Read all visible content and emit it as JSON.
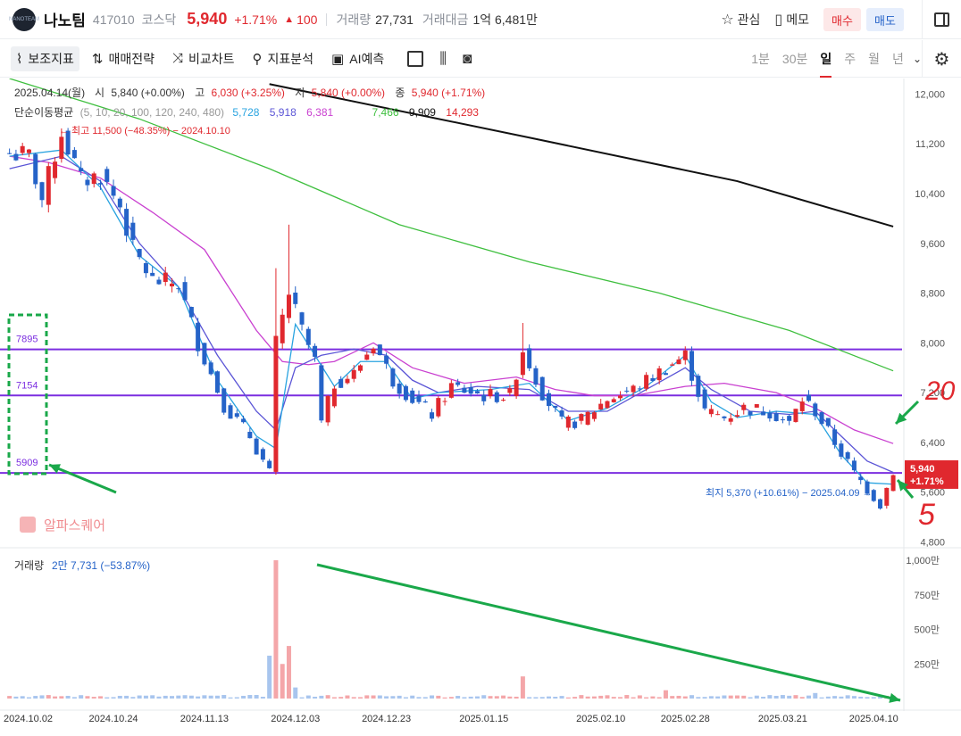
{
  "header": {
    "logo_text": "NANOTEAM",
    "name": "나노팀",
    "code": "417010",
    "market": "코스닥",
    "price": "5,940",
    "change_pct": "+1.71%",
    "change_arrow": "▲",
    "change_abs": "100",
    "volume_label": "거래량",
    "volume": "27,731",
    "amount_label": "거래대금",
    "amount": "1억 6,481만",
    "watch_label": "관심",
    "memo_label": "메모",
    "buy_label": "매수",
    "sell_label": "매도",
    "colors": {
      "up": "#e0282e",
      "down": "#2563c8"
    }
  },
  "toolbar": {
    "tools": [
      "보조지표",
      "매매전략",
      "비교차트",
      "지표분석",
      "AI예측"
    ],
    "periods": [
      "1분",
      "30분",
      "일",
      "주",
      "월",
      "년"
    ],
    "selected_period": "일"
  },
  "ohlc_info": {
    "date": "2025.04.14(월)",
    "open_label": "시",
    "open": "5,840 (+0.00%)",
    "high_label": "고",
    "high": "6,030 (+3.25%)",
    "low_label": "저",
    "low": "5,840 (+0.00%)",
    "close_label": "종",
    "close": "5,940 (+1.71%)"
  },
  "ma_info": {
    "label": "단순이동평균",
    "periods": "(5, 10, 20, 100, 120, 240, 480)",
    "values": [
      {
        "v": "5,728",
        "color": "#29a3e0"
      },
      {
        "v": "5,918",
        "color": "#5b55d6"
      },
      {
        "v": "6,381",
        "color": "#c940d0"
      },
      {
        "v": "7,466",
        "color": "#3fbf3f"
      },
      {
        "v": "9,909",
        "color": "#111111"
      },
      {
        "v": "14,293",
        "color": "#e0282e"
      }
    ]
  },
  "chart_data": {
    "type": "candlestick",
    "y_ticks": [
      "12,000",
      "11,200",
      "10,400",
      "9,600",
      "8,800",
      "8,000",
      "7,200",
      "6,400",
      "5,600",
      "4,800"
    ],
    "y_tick_values": [
      12000,
      11200,
      10400,
      9600,
      8800,
      8000,
      7200,
      6400,
      5600,
      4800
    ],
    "ylim": [
      4720,
      12250
    ],
    "x_ticks": [
      "2024.10.02",
      "2024.10.24",
      "2024.11.13",
      "2024.12.03",
      "2024.12.23",
      "2025.01.15",
      "2025.02.10",
      "2025.02.28",
      "2025.03.21",
      "2025.04.10"
    ],
    "x_tick_index": [
      0,
      16,
      30,
      44,
      58,
      73,
      91,
      104,
      119,
      133
    ],
    "horizontal_lines": [
      {
        "label": "7895",
        "value": 7895,
        "color": "#7b2ee0"
      },
      {
        "label": "7154",
        "value": 7154,
        "color": "#7b2ee0"
      },
      {
        "label": "5909",
        "value": 5909,
        "color": "#7b2ee0"
      }
    ],
    "last_price_badge": {
      "value": 5940,
      "price": "5,940",
      "pct": "+1.71%"
    },
    "annotations": {
      "high": "최고 11,500 (−48.35%) − 2024.10.10",
      "low": "최지 5,370 (+10.61%) − 2025.04.09",
      "hand_20": "20",
      "hand_5": "5"
    },
    "watermark": "알파스퀘어",
    "volume": {
      "label": "거래량",
      "value": "2만 7,731 (−53.87%)",
      "ticks": [
        "1,000만",
        "750만",
        "500만",
        "250만"
      ],
      "tick_values": [
        1000,
        750,
        500,
        250
      ],
      "max": 1000,
      "unit": "만"
    },
    "keypoints": [
      {
        "i": 0,
        "c": 11050
      },
      {
        "i": 3,
        "c": 11000
      },
      {
        "i": 5,
        "c": 10300
      },
      {
        "i": 8,
        "c": 11400
      },
      {
        "i": 11,
        "c": 10600
      },
      {
        "i": 14,
        "c": 10700
      },
      {
        "i": 17,
        "c": 10200
      },
      {
        "i": 19,
        "c": 9500
      },
      {
        "i": 22,
        "c": 9000
      },
      {
        "i": 26,
        "c": 8950
      },
      {
        "i": 29,
        "c": 8000
      },
      {
        "i": 33,
        "c": 7000
      },
      {
        "i": 37,
        "c": 6500
      },
      {
        "i": 40,
        "c": 5900
      },
      {
        "i": 41,
        "c": 8000
      },
      {
        "i": 43,
        "c": 8800
      },
      {
        "i": 45,
        "c": 8200
      },
      {
        "i": 47,
        "c": 7700
      },
      {
        "i": 48,
        "c": 6700
      },
      {
        "i": 50,
        "c": 7350
      },
      {
        "i": 53,
        "c": 7500
      },
      {
        "i": 56,
        "c": 8000
      },
      {
        "i": 59,
        "c": 7400
      },
      {
        "i": 62,
        "c": 7100
      },
      {
        "i": 65,
        "c": 6850
      },
      {
        "i": 68,
        "c": 7300
      },
      {
        "i": 73,
        "c": 7150
      },
      {
        "i": 77,
        "c": 7150
      },
      {
        "i": 79,
        "c": 7900
      },
      {
        "i": 82,
        "c": 7200
      },
      {
        "i": 85,
        "c": 6700
      },
      {
        "i": 88,
        "c": 6750
      },
      {
        "i": 92,
        "c": 7100
      },
      {
        "i": 96,
        "c": 7250
      },
      {
        "i": 101,
        "c": 7600
      },
      {
        "i": 104,
        "c": 7800
      },
      {
        "i": 107,
        "c": 6900
      },
      {
        "i": 110,
        "c": 6800
      },
      {
        "i": 113,
        "c": 6950
      },
      {
        "i": 117,
        "c": 6900
      },
      {
        "i": 120,
        "c": 6700
      },
      {
        "i": 122,
        "c": 7100
      },
      {
        "i": 124,
        "c": 6900
      },
      {
        "i": 127,
        "c": 6400
      },
      {
        "i": 130,
        "c": 5900
      },
      {
        "i": 132,
        "c": 5650
      },
      {
        "i": 134,
        "c": 5400
      },
      {
        "i": 136,
        "c": 5940
      }
    ],
    "volume_spikes": [
      {
        "i": 41,
        "v": 1000
      },
      {
        "i": 40,
        "v": 310
      },
      {
        "i": 43,
        "v": 380
      },
      {
        "i": 42,
        "v": 250
      },
      {
        "i": 79,
        "v": 160
      },
      {
        "i": 44,
        "v": 80
      },
      {
        "i": 101,
        "v": 60
      },
      {
        "i": 124,
        "v": 40
      }
    ],
    "ma_lines": [
      {
        "name": "480",
        "color": "#111111",
        "points": [
          [
            40,
            12160
          ],
          [
            80,
            11300
          ],
          [
            112,
            10600
          ],
          [
            136,
            9870
          ]
        ]
      },
      {
        "name": "240",
        "color": "#3fbf3f",
        "points": [
          [
            0,
            12250
          ],
          [
            20,
            11600
          ],
          [
            40,
            10800
          ],
          [
            60,
            9900
          ],
          [
            80,
            9300
          ],
          [
            100,
            8800
          ],
          [
            120,
            8200
          ],
          [
            136,
            7550
          ]
        ]
      },
      {
        "name": "20",
        "color": "#c940d0",
        "points": [
          [
            0,
            11000
          ],
          [
            6,
            10900
          ],
          [
            14,
            10650
          ],
          [
            22,
            10100
          ],
          [
            30,
            9500
          ],
          [
            38,
            8200
          ],
          [
            42,
            7700
          ],
          [
            46,
            7650
          ],
          [
            50,
            7700
          ],
          [
            56,
            8000
          ],
          [
            62,
            7600
          ],
          [
            70,
            7350
          ],
          [
            78,
            7450
          ],
          [
            84,
            7250
          ],
          [
            90,
            7150
          ],
          [
            96,
            7150
          ],
          [
            104,
            7300
          ],
          [
            110,
            7350
          ],
          [
            118,
            7200
          ],
          [
            124,
            6950
          ],
          [
            130,
            6600
          ],
          [
            136,
            6381
          ]
        ]
      },
      {
        "name": "10",
        "color": "#5b55d6",
        "points": [
          [
            0,
            10800
          ],
          [
            8,
            11000
          ],
          [
            14,
            10600
          ],
          [
            20,
            9600
          ],
          [
            26,
            8900
          ],
          [
            32,
            7800
          ],
          [
            38,
            6900
          ],
          [
            41,
            6600
          ],
          [
            44,
            7600
          ],
          [
            48,
            7800
          ],
          [
            53,
            7900
          ],
          [
            58,
            7800
          ],
          [
            62,
            7400
          ],
          [
            66,
            7200
          ],
          [
            72,
            7300
          ],
          [
            80,
            7250
          ],
          [
            86,
            6900
          ],
          [
            92,
            6900
          ],
          [
            98,
            7250
          ],
          [
            104,
            7600
          ],
          [
            108,
            7250
          ],
          [
            114,
            6900
          ],
          [
            120,
            6850
          ],
          [
            124,
            6900
          ],
          [
            128,
            6500
          ],
          [
            132,
            6100
          ],
          [
            136,
            5918
          ]
        ]
      },
      {
        "name": "5",
        "color": "#29a3e0",
        "points": [
          [
            0,
            11000
          ],
          [
            8,
            11100
          ],
          [
            14,
            10500
          ],
          [
            20,
            9400
          ],
          [
            26,
            8900
          ],
          [
            32,
            7400
          ],
          [
            38,
            6500
          ],
          [
            41,
            6300
          ],
          [
            44,
            8300
          ],
          [
            47,
            7800
          ],
          [
            50,
            7300
          ],
          [
            54,
            7700
          ],
          [
            58,
            7700
          ],
          [
            62,
            7100
          ],
          [
            66,
            7200
          ],
          [
            74,
            7250
          ],
          [
            80,
            7350
          ],
          [
            86,
            6750
          ],
          [
            92,
            6950
          ],
          [
            98,
            7300
          ],
          [
            104,
            7800
          ],
          [
            108,
            7050
          ],
          [
            112,
            6800
          ],
          [
            118,
            6900
          ],
          [
            124,
            6850
          ],
          [
            128,
            6200
          ],
          [
            132,
            5750
          ],
          [
            136,
            5728
          ]
        ]
      }
    ]
  }
}
